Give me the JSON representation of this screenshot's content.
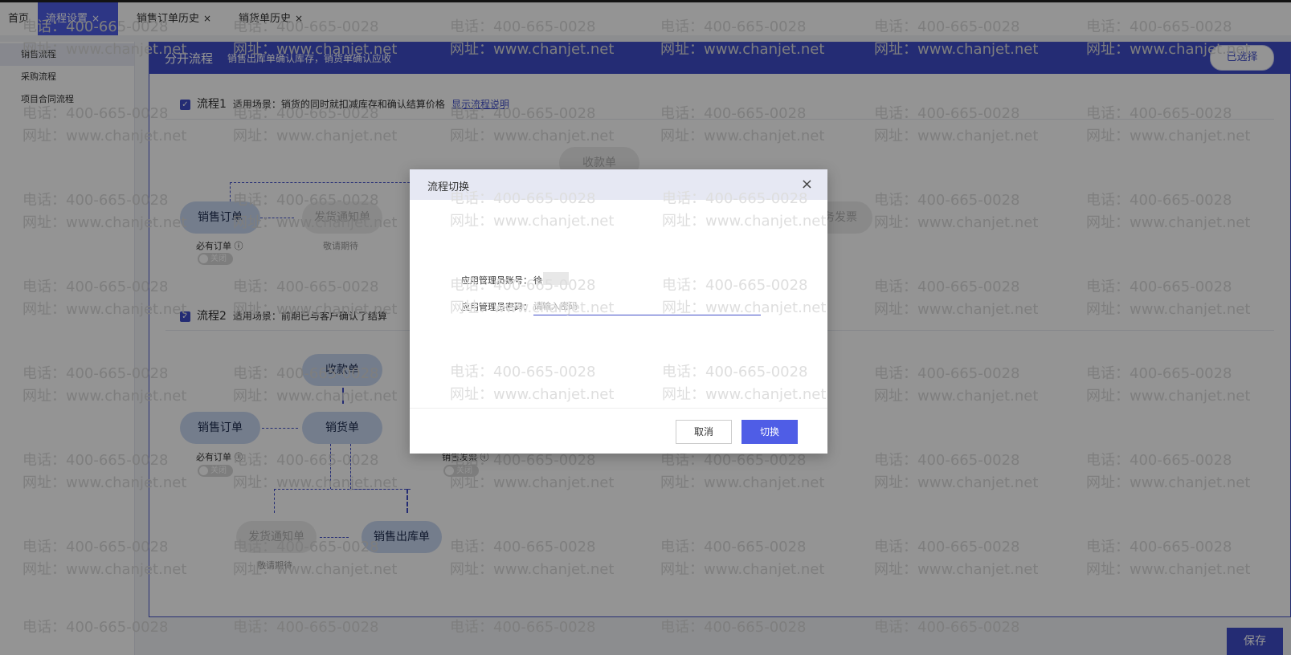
{
  "tabs": [
    {
      "label": "首页",
      "closable": false,
      "active": false
    },
    {
      "label": "流程设置",
      "closable": true,
      "active": true
    },
    {
      "label": "销售订单历史",
      "closable": true,
      "active": false
    },
    {
      "label": "销货单历史",
      "closable": true,
      "active": false
    }
  ],
  "tab_close_glyph": "×",
  "sidebar": {
    "items": [
      {
        "label": "销售流程",
        "active": true
      },
      {
        "label": "采购流程",
        "active": false
      },
      {
        "label": "项目合同流程",
        "active": false
      }
    ]
  },
  "panel": {
    "title": "分开流程",
    "description": "销售出库单确认库存，销货单确认应收",
    "selected_label": "已选择"
  },
  "flow1": {
    "label": "流程1",
    "scene": "适用场景：销货的同时就扣减库存和确认结算价格",
    "link": "显示流程说明",
    "nodes": {
      "sales_order": "销售订单",
      "ship_notice": "发货通知单",
      "receipt": "收款单",
      "invoice_partial": "务发票"
    },
    "must_order": "必有订单",
    "toggle_off": "关闭",
    "expect": "敬请期待"
  },
  "flow2": {
    "label": "流程2",
    "scene": "适用场景：前期已与客户确认了结算",
    "nodes": {
      "sales_order": "销售订单",
      "sales_delivery": "销货单",
      "receipt": "收款单",
      "ship_notice": "发货通知单",
      "outbound": "销售出库单"
    },
    "must_order": "必有订单",
    "sales_invoice": "销售发票",
    "toggle_off": "关闭",
    "expect": "敬请期待"
  },
  "watermark": {
    "phone": "电话：400-665-0028",
    "site": "网址：www.chanjet.net"
  },
  "modal": {
    "title": "流程切换",
    "close": "×",
    "account_label": "应用管理员账号：",
    "account_value_prefix": "徐",
    "password_label": "应用管理员密码：",
    "password_placeholder": "请输入密码",
    "cancel": "取消",
    "confirm": "切换"
  },
  "save_label": "保存",
  "colors": {
    "accent": "#4f5de6",
    "header": "#3f4dc8"
  },
  "icons": {
    "checkbox": "checkbox-checked-icon",
    "help": "question-circle-icon",
    "close": "close-icon"
  }
}
